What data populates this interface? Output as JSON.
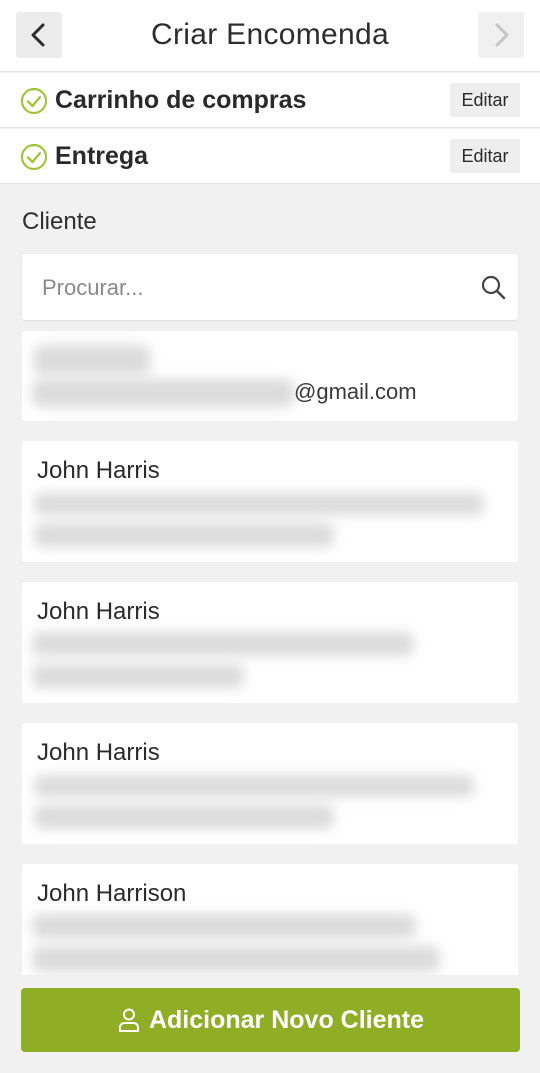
{
  "header": {
    "title": "Criar Encomenda",
    "back_icon": "chevron-left-icon",
    "forward_icon": "chevron-right-icon"
  },
  "steps": [
    {
      "label": "Carrinho de compras",
      "edit_label": "Editar",
      "status_icon": "check-circle-icon"
    },
    {
      "label": "Entrega",
      "edit_label": "Editar",
      "status_icon": "check-circle-icon"
    }
  ],
  "client_section": {
    "title": "Cliente",
    "search": {
      "placeholder": "Procurar...",
      "value": "",
      "icon": "search-icon"
    }
  },
  "clients": [
    {
      "name": "",
      "email_visible_suffix": "@gmail.com"
    },
    {
      "name": "John Harris"
    },
    {
      "name": "John Harris"
    },
    {
      "name": "John Harris"
    },
    {
      "name": "John Harrison"
    }
  ],
  "add_button": {
    "label": "Adicionar Novo Cliente",
    "icon": "user-icon"
  },
  "colors": {
    "accent": "#8fae25",
    "check": "#a3c43a",
    "background": "#f1f1f1"
  }
}
